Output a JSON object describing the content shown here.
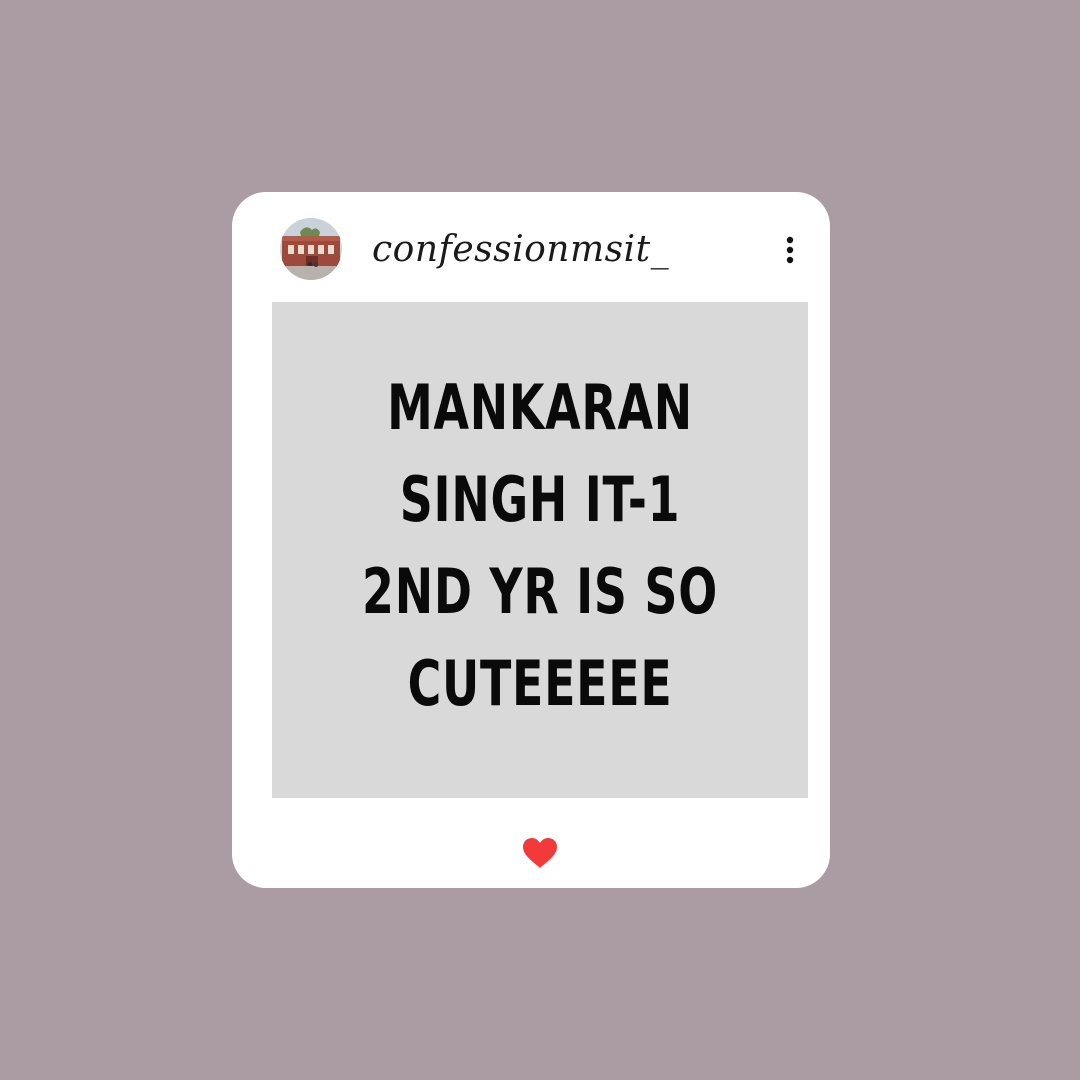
{
  "post": {
    "username": "confessionmsit_",
    "text": "MANKARAN SINGH IT-1\n2ND YR IS SO\nCUTEEEEE",
    "liked": true
  },
  "icons": {
    "avatar": "profile-photo",
    "more": "vertical-ellipsis-icon",
    "like": "heart-icon"
  },
  "colors": {
    "background": "#ab9ca3",
    "card": "#ffffff",
    "post_background": "#d9d9d9",
    "text": "#0a0a0a",
    "heart": "#f23a3a"
  }
}
